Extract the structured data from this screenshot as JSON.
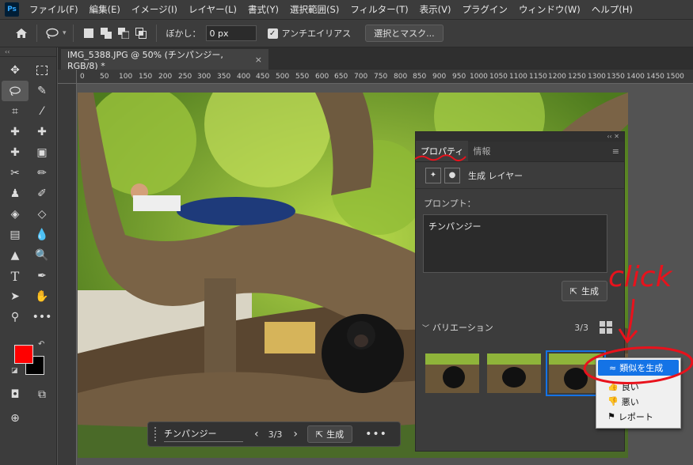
{
  "app": {
    "logo": "Ps"
  },
  "menu": [
    "ファイル(F)",
    "編集(E)",
    "イメージ(I)",
    "レイヤー(L)",
    "書式(Y)",
    "選択範囲(S)",
    "フィルター(T)",
    "表示(V)",
    "プラグイン",
    "ウィンドウ(W)",
    "ヘルプ(H)"
  ],
  "options": {
    "feather_label": "ぼかし：",
    "feather_value": "0 px",
    "antialias_label": "アンチエイリアス",
    "select_mask_label": "選択とマスク..."
  },
  "document_tab": {
    "title": "IMG_5388.JPG @ 50% (チンパンジー, RGB/8) *",
    "close": "×"
  },
  "ruler_ticks": [
    "0",
    "50",
    "100",
    "150",
    "200",
    "250",
    "300",
    "350",
    "400",
    "450",
    "500",
    "550",
    "600",
    "650",
    "700",
    "750",
    "800",
    "850",
    "900",
    "950",
    "1000",
    "1050",
    "1100",
    "1150",
    "1200",
    "1250",
    "1300",
    "1350",
    "1400",
    "1450",
    "1500"
  ],
  "contextual_taskbar": {
    "prompt": "チンパンジー",
    "count": "3/3",
    "generate_label": "生成",
    "more": "•••"
  },
  "properties_panel": {
    "tabs": [
      "プロパティ",
      "情報"
    ],
    "layer_type": "生成 レイヤー",
    "prompt_label": "プロンプト：",
    "prompt_value": "チンパンジー",
    "generate_label": "生成",
    "variations_label": "バリエーション",
    "variations_count": "3/3"
  },
  "context_menu": {
    "items": [
      "類似を生成",
      "良い",
      "悪い",
      "レポート"
    ]
  },
  "annotation": {
    "text": "click",
    "color": "#e8121c"
  },
  "colors": {
    "foreground": "#ff0000",
    "background": "#000000",
    "accent": "#1473e6"
  }
}
